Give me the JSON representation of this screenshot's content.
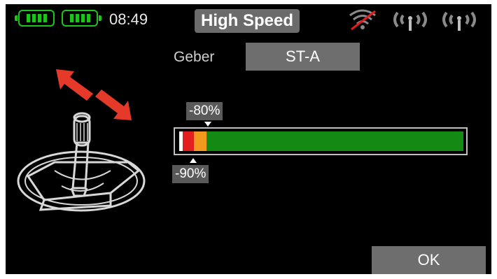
{
  "status_bar": {
    "clock": "08:49",
    "mode_label": "High Speed",
    "battery_color": "#1ec31e",
    "icons": [
      "battery-transmitter-icon",
      "battery-receiver-icon",
      "signal-strength-icon",
      "antenna-icon",
      "antenna-icon"
    ]
  },
  "control": {
    "geber_label": "Geber",
    "geber_value": "ST-A",
    "upper_limit_label": "-80%",
    "lower_limit_label": "-90%",
    "bar": {
      "colors": {
        "red": "#e31e1e",
        "orange": "#f39a1e",
        "green": "#138a13",
        "white": "#ffffff"
      }
    }
  },
  "footer": {
    "ok_label": "OK"
  },
  "illustration": {
    "name": "stick-gimbal",
    "arrow_color": "#e53a2a"
  }
}
